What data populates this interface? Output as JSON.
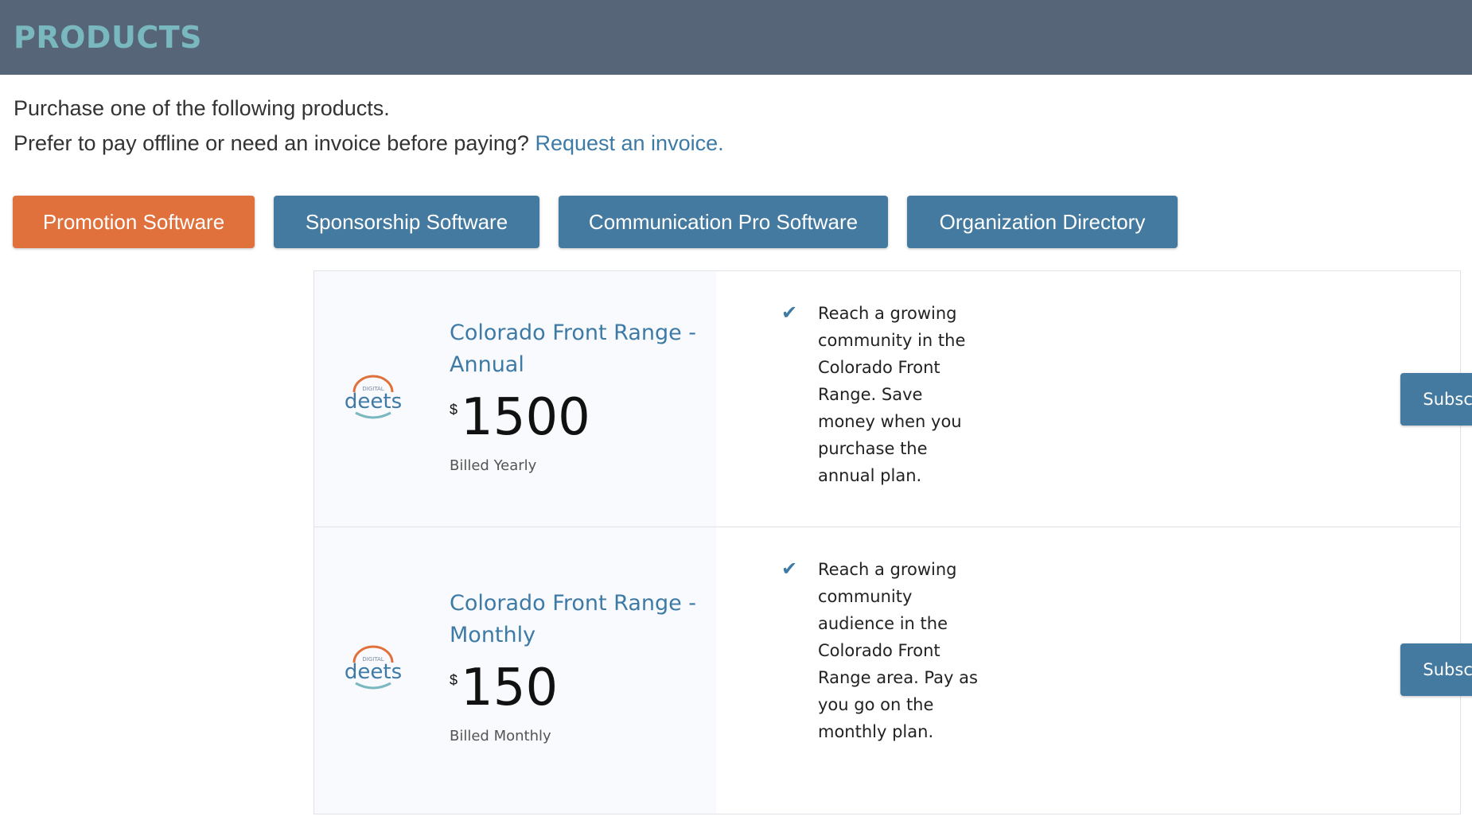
{
  "header": {
    "title": "PRODUCTS"
  },
  "intro": {
    "line1": "Purchase one of the following products.",
    "line2": "Prefer to pay offline or need an invoice before paying?",
    "invoice_link": "Request an invoice."
  },
  "tabs": [
    {
      "label": "Promotion Software",
      "active": true
    },
    {
      "label": "Sponsorship Software",
      "active": false
    },
    {
      "label": "Communication Pro Software",
      "active": false
    },
    {
      "label": "Organization Directory",
      "active": false
    }
  ],
  "logo": {
    "small_text": "DIGITAL",
    "brand": "deets"
  },
  "products": [
    {
      "title": "Colorado Front Range - Annual",
      "currency": "$",
      "price": "1500",
      "billing": "Billed Yearly",
      "description": "Reach a growing community in the Colorado Front Range. Save money when you purchase the annual plan.",
      "button": "Subscribe"
    },
    {
      "title": "Colorado Front Range - Monthly",
      "currency": "$",
      "price": "150",
      "billing": "Billed Monthly",
      "description": "Reach a growing community audience in the Colorado Front Range area. Pay as you go on the monthly plan.",
      "button": "Subscribe"
    }
  ],
  "colors": {
    "header_bg": "#566577",
    "title": "#7ab8c0",
    "active_tab": "#e0703c",
    "button": "#457aa0",
    "link": "#3d7aa6"
  },
  "icons": {
    "check": "checkmark-icon",
    "logo": "digital-deets-logo"
  }
}
